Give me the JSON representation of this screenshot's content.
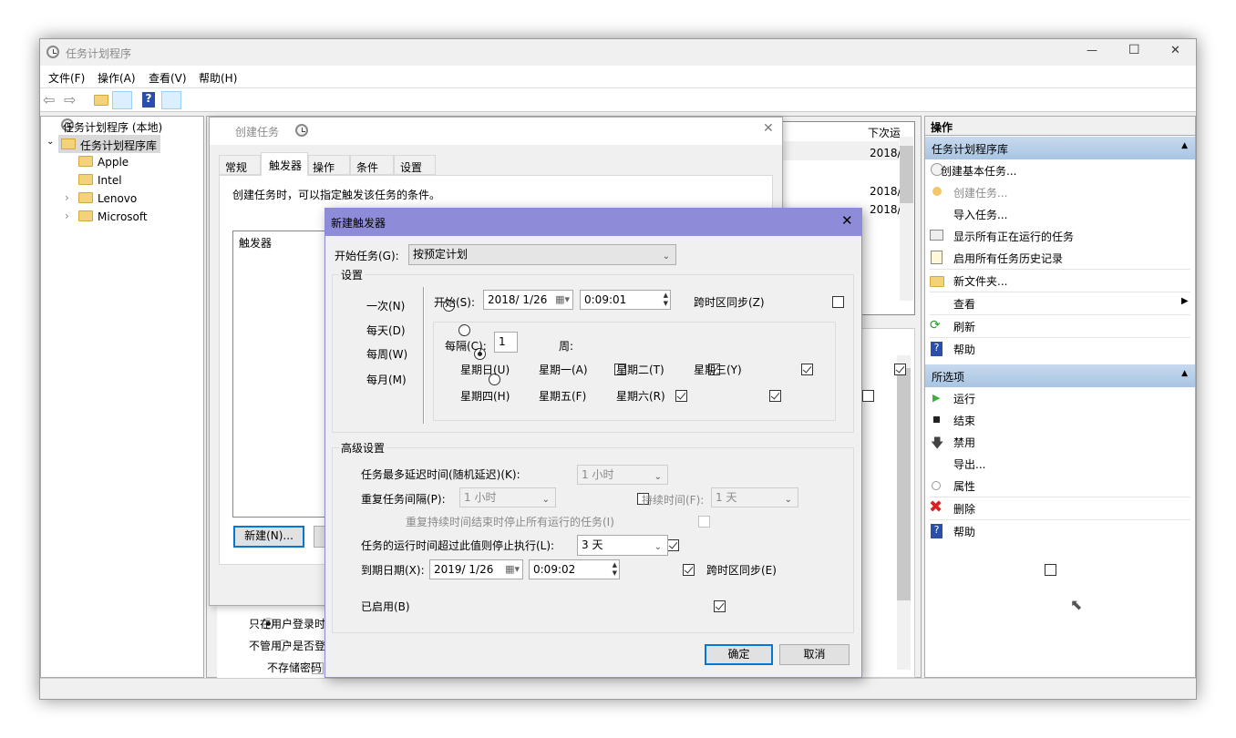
{
  "window": {
    "title": "任务计划程序",
    "minimize": "—",
    "maximize": "☐",
    "close": "✕"
  },
  "menu": [
    "文件(F)",
    "操作(A)",
    "查看(V)",
    "帮助(H)"
  ],
  "tree": {
    "root": "任务计划程序 (本地)",
    "library": "任务计划程序库",
    "folders": [
      "Apple",
      "Intel",
      "Lenovo",
      "Microsoft"
    ]
  },
  "list": {
    "header": "下次运",
    "values": [
      "2018/",
      "2018/",
      "2018/"
    ]
  },
  "create_task": {
    "title": "创建任务",
    "tabs": [
      "常规",
      "触发器",
      "操作",
      "条件",
      "设置"
    ],
    "active_tab": "触发器",
    "description": "创建任务时，可以指定触发该任务的条件。",
    "list_header": "触发器",
    "new_button": "新建(N)..."
  },
  "background_options": {
    "radio1": "只在用户登录时",
    "radio2": "不管用户是否登",
    "checkbox": "不存储密码"
  },
  "actions": {
    "header": "操作",
    "section1": {
      "title": "任务计划程序库",
      "items": [
        "创建基本任务...",
        "创建任务...",
        "导入任务...",
        "显示所有正在运行的任务",
        "启用所有任务历史记录",
        "新文件夹...",
        "查看",
        "刷新",
        "帮助"
      ]
    },
    "section2": {
      "title": "所选项",
      "items": [
        "运行",
        "结束",
        "禁用",
        "导出...",
        "属性",
        "删除",
        "帮助"
      ]
    }
  },
  "trigger": {
    "title": "新建触发器",
    "begin_label": "开始任务(G):",
    "begin_value": "按预定计划",
    "settings_label": "设置",
    "schedule": [
      {
        "label": "一次(N)",
        "checked": false
      },
      {
        "label": "每天(D)",
        "checked": false
      },
      {
        "label": "每周(W)",
        "checked": true
      },
      {
        "label": "每月(M)",
        "checked": false
      }
    ],
    "start_label": "开始(S):",
    "start_date": "2018/  1/26",
    "start_time": "0:09:01",
    "sync_tz": "跨时区同步(Z)",
    "recur_label": "每隔(C):",
    "recur_value": "1",
    "recur_unit": "周:",
    "days": [
      {
        "label": "星期日(U)",
        "checked": false
      },
      {
        "label": "星期一(A)",
        "checked": true
      },
      {
        "label": "星期二(T)",
        "checked": true
      },
      {
        "label": "星期三(Y)",
        "checked": true
      },
      {
        "label": "星期四(H)",
        "checked": true
      },
      {
        "label": "星期五(F)",
        "checked": true
      },
      {
        "label": "星期六(R)",
        "checked": false
      }
    ],
    "advanced_label": "高级设置",
    "delay_label": "任务最多延迟时间(随机延迟)(K):",
    "delay_value": "1 小时",
    "repeat_label": "重复任务间隔(P):",
    "repeat_value": "1 小时",
    "duration_label": "持续时间(F):",
    "duration_value": "1 天",
    "stop_all_label": "重复持续时间结束时停止所有运行的任务(I)",
    "stop_after_label": "任务的运行时间超过此值则停止执行(L):",
    "stop_after_value": "3 天",
    "expire_label": "到期日期(X):",
    "expire_date": "2019/  1/26",
    "expire_time": "0:09:02",
    "expire_sync": "跨时区同步(E)",
    "enabled_label": "已启用(B)",
    "ok": "确定",
    "cancel": "取消"
  },
  "colors": {
    "dialog_title": "#8e8bd8",
    "section_header": "#b4cde6",
    "default_button_border": "#0078d7"
  }
}
